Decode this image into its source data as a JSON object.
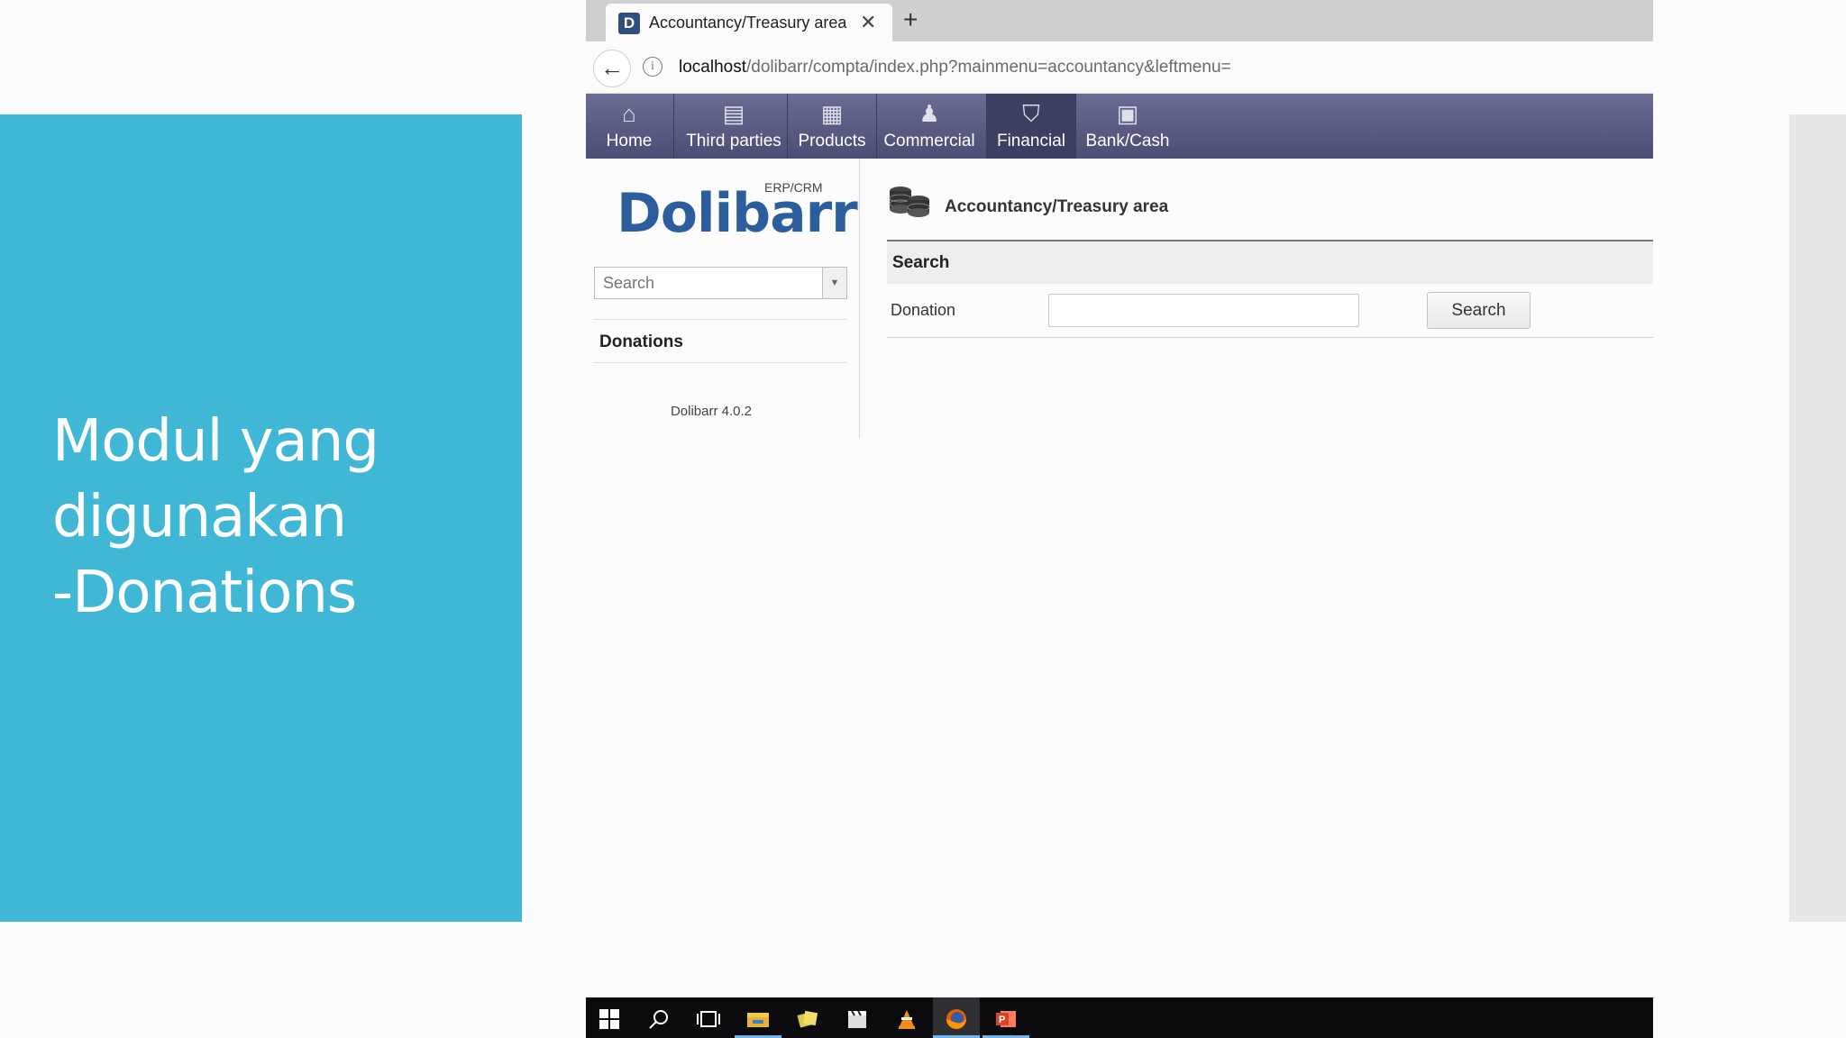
{
  "slide": {
    "title_line1": "Modul yang",
    "title_line2": "digunakan",
    "title_line3": "-Donations",
    "panel_color": "#40b8d5"
  },
  "browser": {
    "tab_title": "Accountancy/Treasury area",
    "favicon_letter": "D",
    "url_host": "localhost",
    "url_path": "/dolibarr/compta/index.php?mainmenu=accountancy&leftmenu="
  },
  "topnav": {
    "items": [
      {
        "label": "Home",
        "icon": "home-icon"
      },
      {
        "label": "Third parties",
        "icon": "buildings-icon"
      },
      {
        "label": "Products",
        "icon": "boxes-icon"
      },
      {
        "label": "Commercial",
        "icon": "person-icon"
      },
      {
        "label": "Financial",
        "icon": "coins-icon",
        "active": true
      },
      {
        "label": "Bank/Cash",
        "icon": "safe-icon"
      }
    ]
  },
  "sidebar": {
    "logo": "Dolibarr",
    "logo_sub": "ERP/CRM",
    "search_placeholder": "Search",
    "menu_item": "Donations",
    "version": "Dolibarr 4.0.2"
  },
  "main": {
    "page_title": "Accountancy/Treasury area",
    "search_header": "Search",
    "row_label": "Donation",
    "donation_value": "",
    "search_button": "Search"
  },
  "taskbar": {
    "apps": [
      "windows-start-icon",
      "search-icon",
      "task-view-icon",
      "file-explorer-icon",
      "notes-icon",
      "video-editor-icon",
      "vlc-icon",
      "firefox-icon",
      "powerpoint-icon"
    ]
  }
}
